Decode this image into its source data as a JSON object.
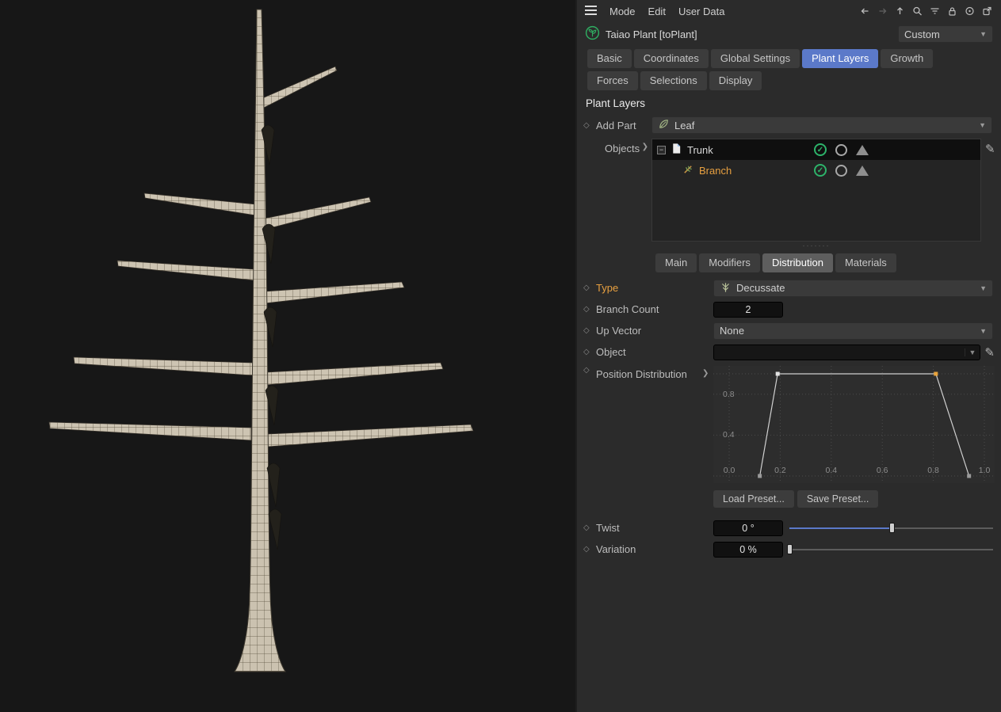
{
  "menubar": {
    "items": [
      "Mode",
      "Edit",
      "User Data"
    ],
    "icons": [
      "back",
      "forward",
      "up",
      "search",
      "filter",
      "lock",
      "target",
      "external-link"
    ]
  },
  "header": {
    "title": "Taiao Plant [toPlant]",
    "preset": "Custom"
  },
  "tabs_row1": [
    "Basic",
    "Coordinates",
    "Global Settings",
    "Plant Layers",
    "Growth"
  ],
  "tabs_row2": [
    "Forces",
    "Selections",
    "Display"
  ],
  "active_tab": "Plant Layers",
  "section": {
    "title": "Plant Layers"
  },
  "add_part": {
    "label": "Add Part",
    "value": "Leaf"
  },
  "objects": {
    "label": "Objects",
    "items": [
      {
        "name": "Trunk"
      },
      {
        "name": "Branch"
      }
    ]
  },
  "subtabs": [
    "Main",
    "Modifiers",
    "Distribution",
    "Materials"
  ],
  "active_subtab": "Distribution",
  "params": {
    "type": {
      "label": "Type",
      "value": "Decussate"
    },
    "branch_count": {
      "label": "Branch Count",
      "value": "2"
    },
    "up_vector": {
      "label": "Up Vector",
      "value": "None"
    },
    "object": {
      "label": "Object",
      "value": ""
    },
    "position_distribution": {
      "label": "Position Distribution"
    },
    "twist": {
      "label": "Twist",
      "value": "0 °",
      "slider_pos": 0.5
    },
    "variation": {
      "label": "Variation",
      "value": "0 %",
      "slider_pos": 0.0
    }
  },
  "presets": {
    "load": "Load Preset...",
    "save": "Save Preset..."
  },
  "curve": {
    "x_ticks": [
      "0.0",
      "0.2",
      "0.4",
      "0.6",
      "0.8",
      "1.0"
    ],
    "y_ticks": [
      "0.8",
      "0.4"
    ],
    "points": [
      {
        "x": 0.12,
        "y": 0.0,
        "color": "#9a9a9a"
      },
      {
        "x": 0.19,
        "y": 1.0,
        "color": "#e2e2e2"
      },
      {
        "x": 0.81,
        "y": 1.0,
        "color": "#e8a33c"
      },
      {
        "x": 0.94,
        "y": 0.0,
        "color": "#9a9a9a"
      }
    ]
  },
  "colors": {
    "accent_blue": "#5b79c9",
    "accent_orange": "#e8a040",
    "green": "#2db36a"
  }
}
